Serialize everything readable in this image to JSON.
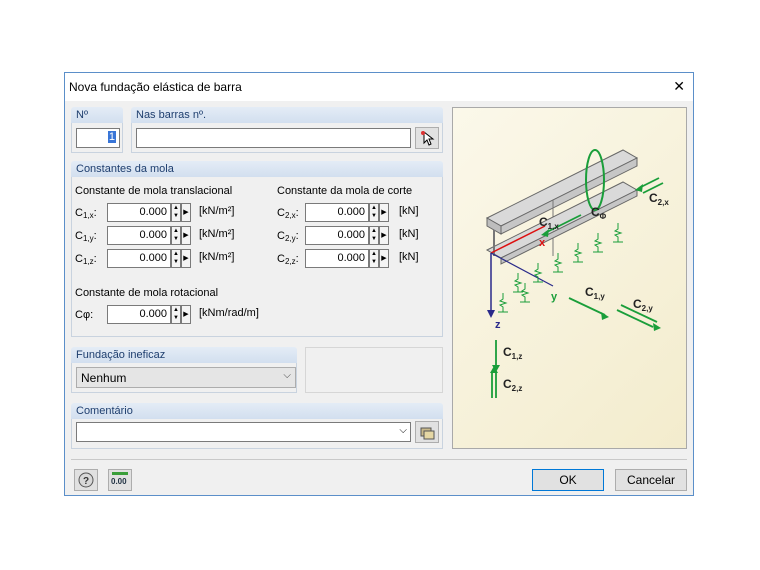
{
  "window": {
    "title": "Nova fundação elástica de barra",
    "close": "✕"
  },
  "no": {
    "label": "Nº",
    "value": "1"
  },
  "bars": {
    "label": "Nas barras nº.",
    "value": ""
  },
  "springs": {
    "title": "Constantes da mola",
    "translational_title": "Constante de mola translacional",
    "shear_title": "Constante da mola de corte",
    "rotational_title": "Constante de mola rotacional",
    "c1": [
      {
        "sym": "C",
        "sub": "1,x",
        "value": "0.000",
        "unit": "[kN/m²]"
      },
      {
        "sym": "C",
        "sub": "1,y",
        "value": "0.000",
        "unit": "[kN/m²]"
      },
      {
        "sym": "C",
        "sub": "1,z",
        "value": "0.000",
        "unit": "[kN/m²]"
      }
    ],
    "c2": [
      {
        "sym": "C",
        "sub": "2,x",
        "value": "0.000",
        "unit": "[kN]"
      },
      {
        "sym": "C",
        "sub": "2,y",
        "value": "0.000",
        "unit": "[kN]"
      },
      {
        "sym": "C",
        "sub": "2,z",
        "value": "0.000",
        "unit": "[kN]"
      }
    ],
    "cphi": {
      "sym": "Cφ:",
      "value": "0.000",
      "unit": "[kNm/rad/m]"
    }
  },
  "ineffective": {
    "title": "Fundação ineficaz",
    "value": "Nenhum"
  },
  "comment": {
    "title": "Comentário",
    "value": ""
  },
  "diagram": {
    "c2x": "C",
    "c2x_sub": "2,x",
    "c1x": "C",
    "c1x_sub": "1,x",
    "cphi": "C",
    "cphi_sub": "Φ",
    "c1y": "C",
    "c1y_sub": "1,y",
    "c2y": "C",
    "c2y_sub": "2,y",
    "c1z": "C",
    "c1z_sub": "1,z",
    "c2z": "C",
    "c2z_sub": "2,z",
    "ax_x": "x",
    "ax_y": "y",
    "ax_z": "z"
  },
  "footer": {
    "ok": "OK",
    "cancel": "Cancelar",
    "units_icon": "0.00"
  }
}
